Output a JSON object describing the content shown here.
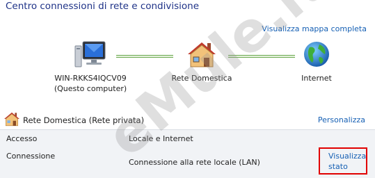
{
  "header": {
    "title": "Centro connessioni di rete e condivisione"
  },
  "map_link": "Visualizza mappa completa",
  "network_map": {
    "computer": {
      "name": "WIN-RKKS4IQCV09",
      "subtitle": "(Questo computer)",
      "icon": "computer-icon"
    },
    "home": {
      "name": "Rete Domestica",
      "icon": "house-icon"
    },
    "internet": {
      "name": "Internet",
      "icon": "globe-icon"
    }
  },
  "network": {
    "title": "Rete Domestica (Rete privata)",
    "customize_link": "Personalizza",
    "access_label": "Accesso",
    "access_value": "Locale e Internet",
    "connection_label": "Connessione",
    "connection_value": "Connessione alla rete locale (LAN)",
    "status_link_line1": "Visualizza",
    "status_link_line2": "stato"
  },
  "watermark": "eMule.it",
  "colors": {
    "title": "#1e3287",
    "link": "#1660b4",
    "highlight_box": "#e10000",
    "details_bg": "#f1f3f6"
  }
}
